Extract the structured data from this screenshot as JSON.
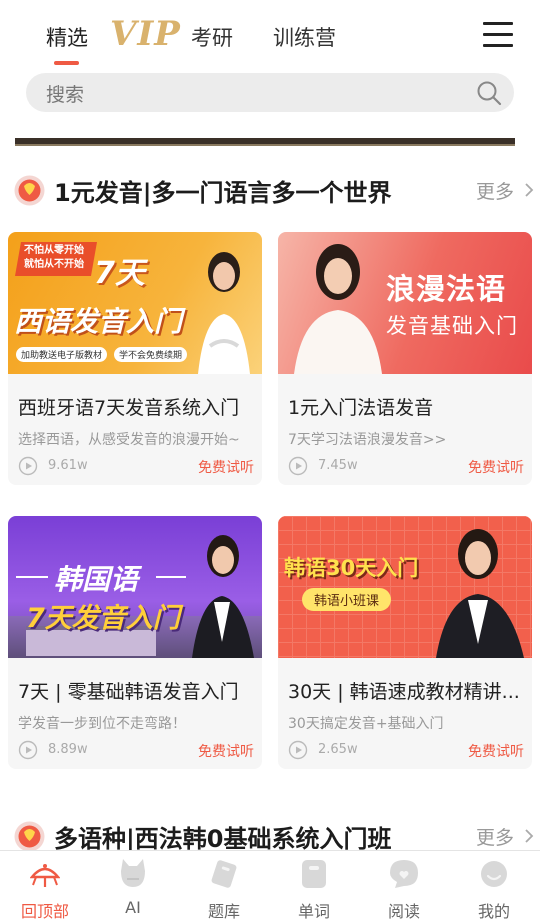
{
  "topnav": {
    "tabs": [
      {
        "label": "精选",
        "active": true
      },
      {
        "label": "考研",
        "active": false
      },
      {
        "label": "训练营",
        "active": false
      }
    ],
    "vip_label": "VIP",
    "accent_color": "#ef5a44"
  },
  "search": {
    "placeholder": "搜索"
  },
  "sections": [
    {
      "title": "1元发音|多一门语言多一个世界",
      "more": "更多",
      "courses": [
        {
          "title": "西班牙语7天发音系统入门",
          "subtitle": "选择西语，从感受发音的浪漫开始~",
          "plays": "9.61w",
          "trial": "免费试听",
          "thumb": {
            "top1": "不怕从零开始",
            "top2": "就怕从不开始",
            "big": "7天",
            "line": "西语发音入门",
            "badge1": "加助教送电子版教材",
            "badge2": "学不会免费续期"
          }
        },
        {
          "title": "1元入门法语发音",
          "subtitle": "7天学习法语浪漫发音>>",
          "plays": "7.45w",
          "trial": "免费试听",
          "thumb": {
            "big": "浪漫法语",
            "line": "发音基础入门"
          }
        },
        {
          "title": "7天 | 零基础韩语发音入门",
          "subtitle": "学发音一步到位不走弯路！",
          "plays": "8.89w",
          "trial": "免费试听",
          "thumb": {
            "big": "韩国语",
            "line": "7天发音入门"
          }
        },
        {
          "title": "30天 | 韩语速成教材精讲...",
          "subtitle": "30天搞定发音+基础入门",
          "plays": "2.65w",
          "trial": "免费试听",
          "thumb": {
            "big": "韩语30天入门",
            "pill": "韩语小班课"
          }
        }
      ]
    },
    {
      "title": "多语种|西法韩0基础系统入门班",
      "more": "更多"
    }
  ],
  "bottombar": {
    "items": [
      {
        "label": "回顶部",
        "icon": "umbrella-top-icon",
        "active": true
      },
      {
        "label": "AI",
        "icon": "ai-cat-icon",
        "active": false
      },
      {
        "label": "题库",
        "icon": "question-bank-icon",
        "active": false
      },
      {
        "label": "单词",
        "icon": "word-card-icon",
        "active": false
      },
      {
        "label": "阅读",
        "icon": "read-bubble-icon",
        "active": false
      },
      {
        "label": "我的",
        "icon": "profile-face-icon",
        "active": false
      }
    ]
  }
}
